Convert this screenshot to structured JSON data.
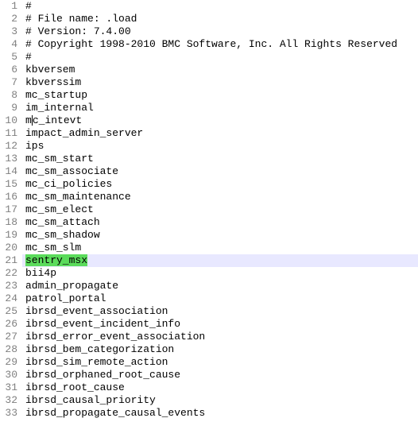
{
  "lines": [
    {
      "num": 1,
      "text": "#",
      "highlight": false,
      "textHighlight": false
    },
    {
      "num": 2,
      "text": "# File name: .load",
      "highlight": false,
      "textHighlight": false
    },
    {
      "num": 3,
      "text": "# Version: 7.4.00",
      "highlight": false,
      "textHighlight": false
    },
    {
      "num": 4,
      "text": "# Copyright 1998-2010 BMC Software, Inc. All Rights Reserved",
      "highlight": false,
      "textHighlight": false
    },
    {
      "num": 5,
      "text": "#",
      "highlight": false,
      "textHighlight": false
    },
    {
      "num": 6,
      "text": "kbversem",
      "highlight": false,
      "textHighlight": false
    },
    {
      "num": 7,
      "text": "kbverssim",
      "highlight": false,
      "textHighlight": false
    },
    {
      "num": 8,
      "text": "mc_startup",
      "highlight": false,
      "textHighlight": false
    },
    {
      "num": 9,
      "text": "im_internal",
      "highlight": false,
      "textHighlight": false
    },
    {
      "num": 10,
      "text": "mc_intevt",
      "highlight": false,
      "textHighlight": false,
      "cursor": true
    },
    {
      "num": 11,
      "text": "impact_admin_server",
      "highlight": false,
      "textHighlight": false
    },
    {
      "num": 12,
      "text": "ips",
      "highlight": false,
      "textHighlight": false
    },
    {
      "num": 13,
      "text": "mc_sm_start",
      "highlight": false,
      "textHighlight": false
    },
    {
      "num": 14,
      "text": "mc_sm_associate",
      "highlight": false,
      "textHighlight": false
    },
    {
      "num": 15,
      "text": "mc_ci_policies",
      "highlight": false,
      "textHighlight": false
    },
    {
      "num": 16,
      "text": "mc_sm_maintenance",
      "highlight": false,
      "textHighlight": false
    },
    {
      "num": 17,
      "text": "mc_sm_elect",
      "highlight": false,
      "textHighlight": false
    },
    {
      "num": 18,
      "text": "mc_sm_attach",
      "highlight": false,
      "textHighlight": false
    },
    {
      "num": 19,
      "text": "mc_sm_shadow",
      "highlight": false,
      "textHighlight": false
    },
    {
      "num": 20,
      "text": "mc_sm_slm",
      "highlight": false,
      "textHighlight": false
    },
    {
      "num": 21,
      "text": "sentry_msx",
      "highlight": true,
      "textHighlight": true
    },
    {
      "num": 22,
      "text": "bii4p",
      "highlight": false,
      "textHighlight": false
    },
    {
      "num": 23,
      "text": "admin_propagate",
      "highlight": false,
      "textHighlight": false
    },
    {
      "num": 24,
      "text": "patrol_portal",
      "highlight": false,
      "textHighlight": false
    },
    {
      "num": 25,
      "text": "ibrsd_event_association",
      "highlight": false,
      "textHighlight": false
    },
    {
      "num": 26,
      "text": "ibrsd_event_incident_info",
      "highlight": false,
      "textHighlight": false
    },
    {
      "num": 27,
      "text": "ibrsd_error_event_association",
      "highlight": false,
      "textHighlight": false
    },
    {
      "num": 28,
      "text": "ibrsd_bem_categorization",
      "highlight": false,
      "textHighlight": false
    },
    {
      "num": 29,
      "text": "ibrsd_sim_remote_action",
      "highlight": false,
      "textHighlight": false
    },
    {
      "num": 30,
      "text": "ibrsd_orphaned_root_cause",
      "highlight": false,
      "textHighlight": false
    },
    {
      "num": 31,
      "text": "ibrsd_root_cause",
      "highlight": false,
      "textHighlight": false
    },
    {
      "num": 32,
      "text": "ibrsd_causal_priority",
      "highlight": false,
      "textHighlight": false
    },
    {
      "num": 33,
      "text": "ibrsd_propagate_causal_events",
      "highlight": false,
      "textHighlight": false
    }
  ]
}
